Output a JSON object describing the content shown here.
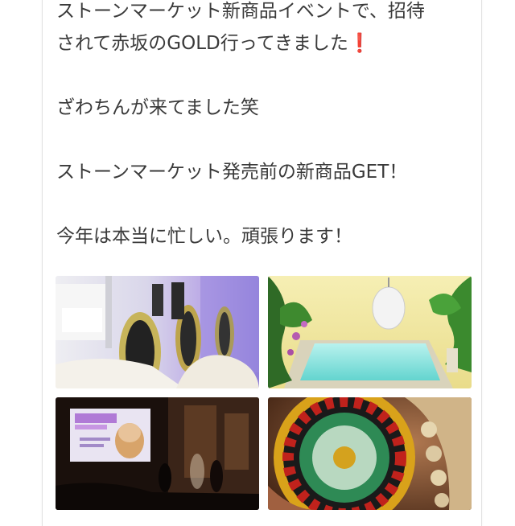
{
  "post": {
    "line1": "ストーンマーケット新商品イベントで、招待",
    "line2": "されて赤坂のGOLD行ってきました",
    "line2_mark": "❗",
    "line3": "ざわちんが来てました笑",
    "line4": "ストーンマーケット発売前の新商品GET！",
    "line5": "今年は本当に忙しい。頑張ります！"
  },
  "photos": [
    {
      "icon": "event-room-photo"
    },
    {
      "icon": "jacuzzi-photo"
    },
    {
      "icon": "stage-screen-photo"
    },
    {
      "icon": "roulette-watch-photo"
    }
  ],
  "colors": {
    "text": "#3a3a3a",
    "accent_exclamation": "#d52a2a"
  }
}
